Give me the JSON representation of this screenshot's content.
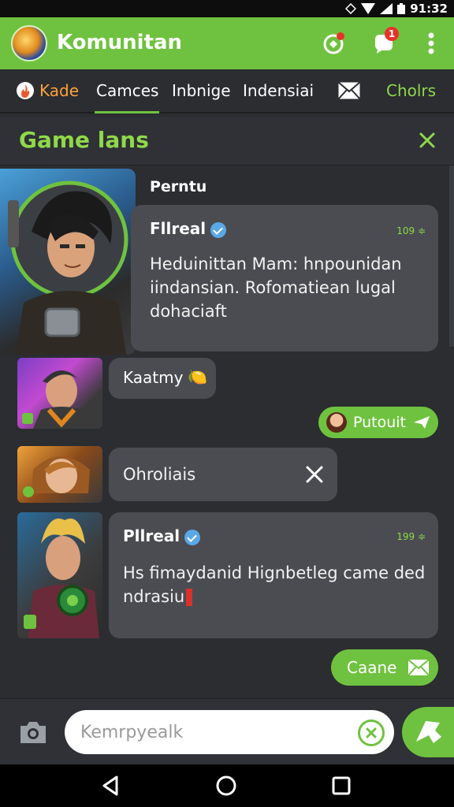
{
  "status_bar": {
    "time": "91:32",
    "icons": [
      "signal-icon",
      "wifi-icon",
      "battery-icon"
    ]
  },
  "app_bar": {
    "title": "Komunitan",
    "icons": [
      "app-logo",
      "notification-icon",
      "chat-icon",
      "more-icon"
    ],
    "notification_badge": "1"
  },
  "tabs": {
    "items": [
      {
        "label": "Kade",
        "icon": "fire-icon"
      },
      {
        "label": "Camces"
      },
      {
        "label": "Inbnige"
      },
      {
        "label": "Indensiai"
      },
      {
        "label": "",
        "icon": "mail-icon"
      },
      {
        "label": "Cholrs"
      }
    ],
    "selected": "Camces"
  },
  "section": {
    "title": "Game lans",
    "close_icon": "close-icon"
  },
  "messages": [
    {
      "header": "Perntu",
      "name": "Fllreal",
      "verified": true,
      "meta": "109 ≑",
      "text": "Heduinittan Mam: hnpounidan iindansian. Rofomatiean lugal dohaciaft"
    },
    {
      "name": "Kaatmy",
      "emoji": "🍋"
    },
    {
      "pill_label": "Putouit",
      "icon": "send-arrow-icon"
    },
    {
      "text": "Ohroliais",
      "close_icon": "close-icon"
    },
    {
      "name": "Pllreal",
      "verified": true,
      "meta": "199 ≑",
      "text": "Hs fimaydanid Hignbetleg came ded ndrasiu"
    },
    {
      "pill_label": "Caane",
      "icon": "mail-icon"
    }
  ],
  "composer": {
    "placeholder": "Kemrpyealk",
    "camera_icon": "camera-icon",
    "clear_icon": "clear-icon",
    "send_icon": "send-icon"
  },
  "nav_bar": {
    "buttons": [
      "back-icon",
      "home-icon",
      "recents-icon"
    ]
  },
  "colors": {
    "accent": "#6fc23f",
    "accent_text": "#8fd94a",
    "background": "#2b2d31",
    "bubble": "#4a4c52"
  }
}
